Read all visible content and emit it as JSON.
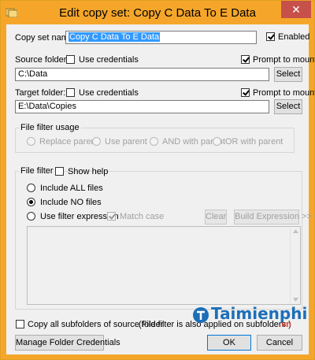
{
  "window": {
    "title": "Edit copy set: Copy C Data To E Data",
    "close_glyph": "✕"
  },
  "copy_set": {
    "label": "Copy set name:",
    "value": "Copy C Data To E Data",
    "enabled_label": "Enabled",
    "enabled": true
  },
  "source": {
    "label": "Source folder:",
    "use_credentials_label": "Use credentials",
    "use_credentials": false,
    "prompt_label": "Prompt to mount",
    "prompt": true,
    "value": "C:\\Data",
    "select_label": "Select"
  },
  "target": {
    "label": "Target folder:",
    "use_credentials_label": "Use credentials",
    "use_credentials": false,
    "prompt_label": "Prompt to mount",
    "prompt": true,
    "value": "E:\\Data\\Copies",
    "select_label": "Select"
  },
  "file_filter_usage": {
    "title": "File filter usage",
    "options": [
      "Replace parent",
      "Use parent",
      "AND with parent",
      "OR with parent"
    ]
  },
  "file_filter": {
    "title": "File filter",
    "show_help_label": "Show help",
    "show_help": false,
    "options": [
      "Include ALL files",
      "Include NO files",
      "Use filter expression"
    ],
    "selected": 1,
    "match_case_label": "Match case",
    "match_case": true,
    "clear_label": "Clear",
    "build_label": "Build Expression >>"
  },
  "footer": {
    "copy_subfolders_label": "Copy all subfolders of source folder",
    "copy_subfolders": false,
    "note": "(File filter is also applied on subfolders.)",
    "manage_label": "Manage Folder Credentials",
    "ok_label": "OK",
    "cancel_label": "Cancel"
  },
  "watermark": {
    "brand": "Taimienphi",
    "suffix": ".vn"
  },
  "colors": {
    "titlebar": "#f5a62a",
    "close": "#c7504a",
    "selection": "#3399ff",
    "watermark": "#1d6fb8"
  }
}
